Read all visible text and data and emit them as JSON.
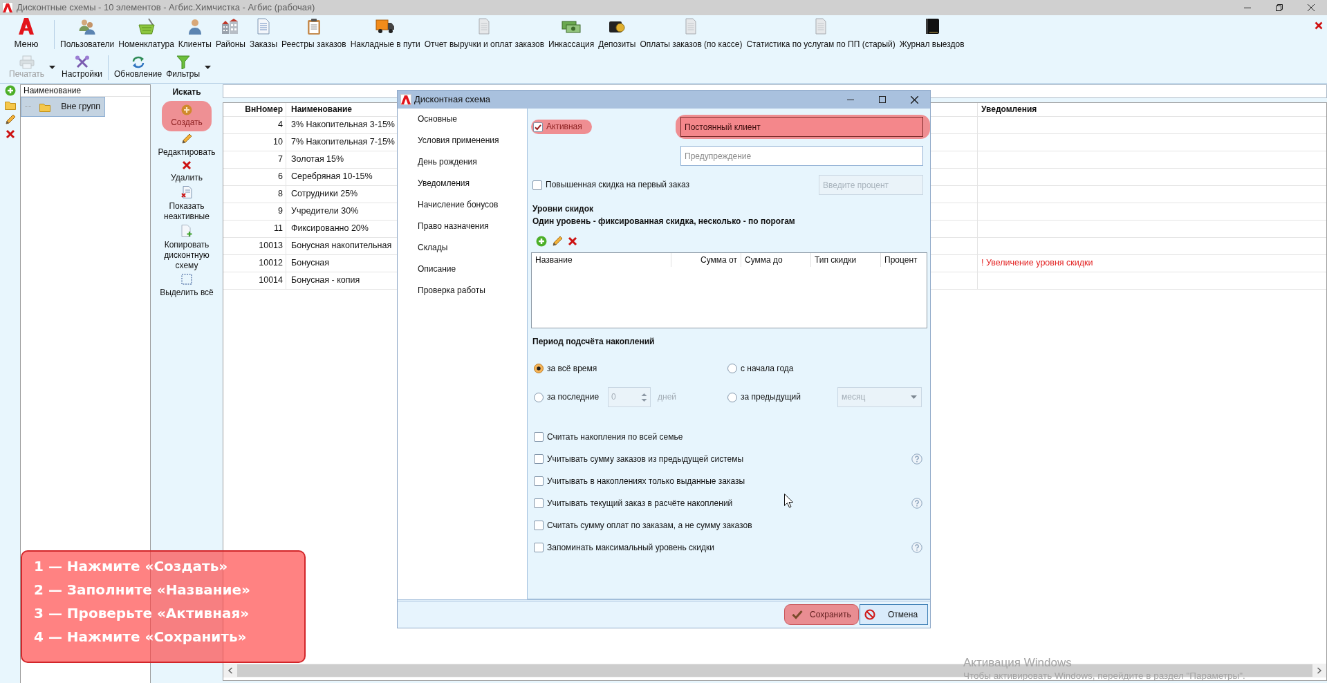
{
  "window": {
    "title": "Дисконтные схемы - 10 элементов - Агбис.Химчистка - Агбис (рабочая)"
  },
  "ribbon": {
    "menu": {
      "label": "Меню"
    },
    "modules": [
      {
        "label": "Пользователи"
      },
      {
        "label": "Номенклатура"
      },
      {
        "label": "Клиенты"
      },
      {
        "label": "Районы"
      },
      {
        "label": "Заказы"
      },
      {
        "label": "Реестры заказов"
      },
      {
        "label": "Накладные в пути"
      },
      {
        "label": "Отчет выручки и оплат заказов"
      },
      {
        "label": "Инкассация"
      },
      {
        "label": "Депозиты"
      },
      {
        "label": "Оплаты заказов (по кассе)"
      },
      {
        "label": "Статистика по услугам по ПП (старый)"
      },
      {
        "label": "Журнал выездов"
      }
    ],
    "tool_groups": [
      [
        {
          "label": "Печатать",
          "disabled": true,
          "dropdown": true
        },
        {
          "label": "Настройки",
          "disabled": false,
          "dropdown": false
        }
      ],
      [
        {
          "label": "Обновление",
          "disabled": false,
          "dropdown": false
        },
        {
          "label": "Фильтры",
          "disabled": false,
          "dropdown": true
        }
      ]
    ]
  },
  "groups_tree": {
    "header": "Наименование",
    "items": [
      {
        "label": "Вне групп",
        "selected": true
      }
    ]
  },
  "actions": {
    "title": "Искать",
    "buttons": [
      {
        "label": "Создать",
        "highlighted": true
      },
      {
        "label": "Редактировать",
        "highlighted": false
      },
      {
        "label": "Удалить",
        "highlighted": false
      },
      {
        "label": "Показать неактивные",
        "highlighted": false
      },
      {
        "label": "Копировать дисконтную схему",
        "highlighted": false
      },
      {
        "label": "Выделить всё",
        "highlighted": false
      }
    ]
  },
  "table": {
    "columns": [
      "ВнНомер",
      "Наименование",
      "Уведомления"
    ],
    "rows": [
      {
        "number": "4",
        "name": "3% Накопительная 3-15%"
      },
      {
        "number": "10",
        "name": "7% Накопительная 7-15%"
      },
      {
        "number": "7",
        "name": "Золотая 15%"
      },
      {
        "number": "6",
        "name": "Серебряная 10-15%"
      },
      {
        "number": "8",
        "name": "Сотрудники 25%"
      },
      {
        "number": "9",
        "name": "Учредители 30%"
      },
      {
        "number": "11",
        "name": "Фиксированно 20%"
      },
      {
        "number": "10013",
        "name": "Бонусная накопительная"
      },
      {
        "number": "10012",
        "name": "Бонусная",
        "notification": "! Увеличение уровня скидки"
      },
      {
        "number": "10014",
        "name": "Бонусная - копия"
      }
    ]
  },
  "dialog": {
    "title": "Дисконтная схема",
    "sections": [
      {
        "label": "Основные"
      },
      {
        "label": "Условия применения"
      },
      {
        "label": "День рождения"
      },
      {
        "label": "Уведомления"
      },
      {
        "label": "Начисление бонусов"
      },
      {
        "label": "Право назначения"
      },
      {
        "label": "Склады"
      },
      {
        "label": "Описание"
      },
      {
        "label": "Проверка работы"
      }
    ],
    "active": {
      "label": "Активная",
      "checked": true,
      "highlighted": true
    },
    "name_field": {
      "value": "Постоянный клиент",
      "highlighted": true
    },
    "warning_field": {
      "placeholder": "Предупреждение"
    },
    "first_order_discount": {
      "label": "Повышенная скидка на первый заказ",
      "checked": false
    },
    "percent_field": {
      "placeholder": "Введите процент",
      "disabled": true
    },
    "levels": {
      "title": "Уровни скидок",
      "subtitle": "Один уровень - фиксированная скидка, несколько - по порогам",
      "columns": [
        "Название",
        "Сумма от",
        "Сумма до",
        "Тип скидки",
        "Процент"
      ]
    },
    "period": {
      "title": "Период подсчёта накоплений",
      "options": [
        {
          "kind": "simple",
          "label": "за всё время",
          "selected": true
        },
        {
          "kind": "simple",
          "label": "с начала года",
          "selected": false
        },
        {
          "kind": "days",
          "label": "за последние",
          "selected": false,
          "field": {
            "value": "0",
            "disabled": true
          },
          "unit": "дней"
        },
        {
          "kind": "previous",
          "label": "за предыдущий",
          "selected": false,
          "field": {
            "value": "месяц",
            "disabled": true
          }
        }
      ]
    },
    "flags": [
      {
        "label": "Считать накопления по всей семье",
        "checked": false,
        "help": false
      },
      {
        "label": "Учитывать сумму заказов из предыдущей системы",
        "checked": false,
        "help": true
      },
      {
        "label": "Учитывать в накоплениях только выданные заказы",
        "checked": false,
        "help": false
      },
      {
        "label": "Учитывать текущий заказ в расчёте накоплений",
        "checked": false,
        "help": true
      },
      {
        "label": "Считать сумму оплат по заказам, а не сумму заказов",
        "checked": false,
        "help": false
      },
      {
        "label": "Запоминать максимальный уровень скидки",
        "checked": false,
        "help": true
      }
    ],
    "buttons": [
      {
        "kind": "save",
        "label": "Сохранить",
        "highlighted": true
      },
      {
        "kind": "cancel",
        "label": "Отмена",
        "highlighted": false
      }
    ]
  },
  "instructions": {
    "steps": [
      "1 — Нажмите «Создать»",
      "2 — Заполните «Название»",
      "3 — Проверьте «Активная»",
      "4 — Нажмите «Сохранить»"
    ]
  },
  "activation_notice": {
    "title": "Активация Windows",
    "text": "Чтобы активировать Windows, перейдите в раздел \"Параметры\"."
  }
}
